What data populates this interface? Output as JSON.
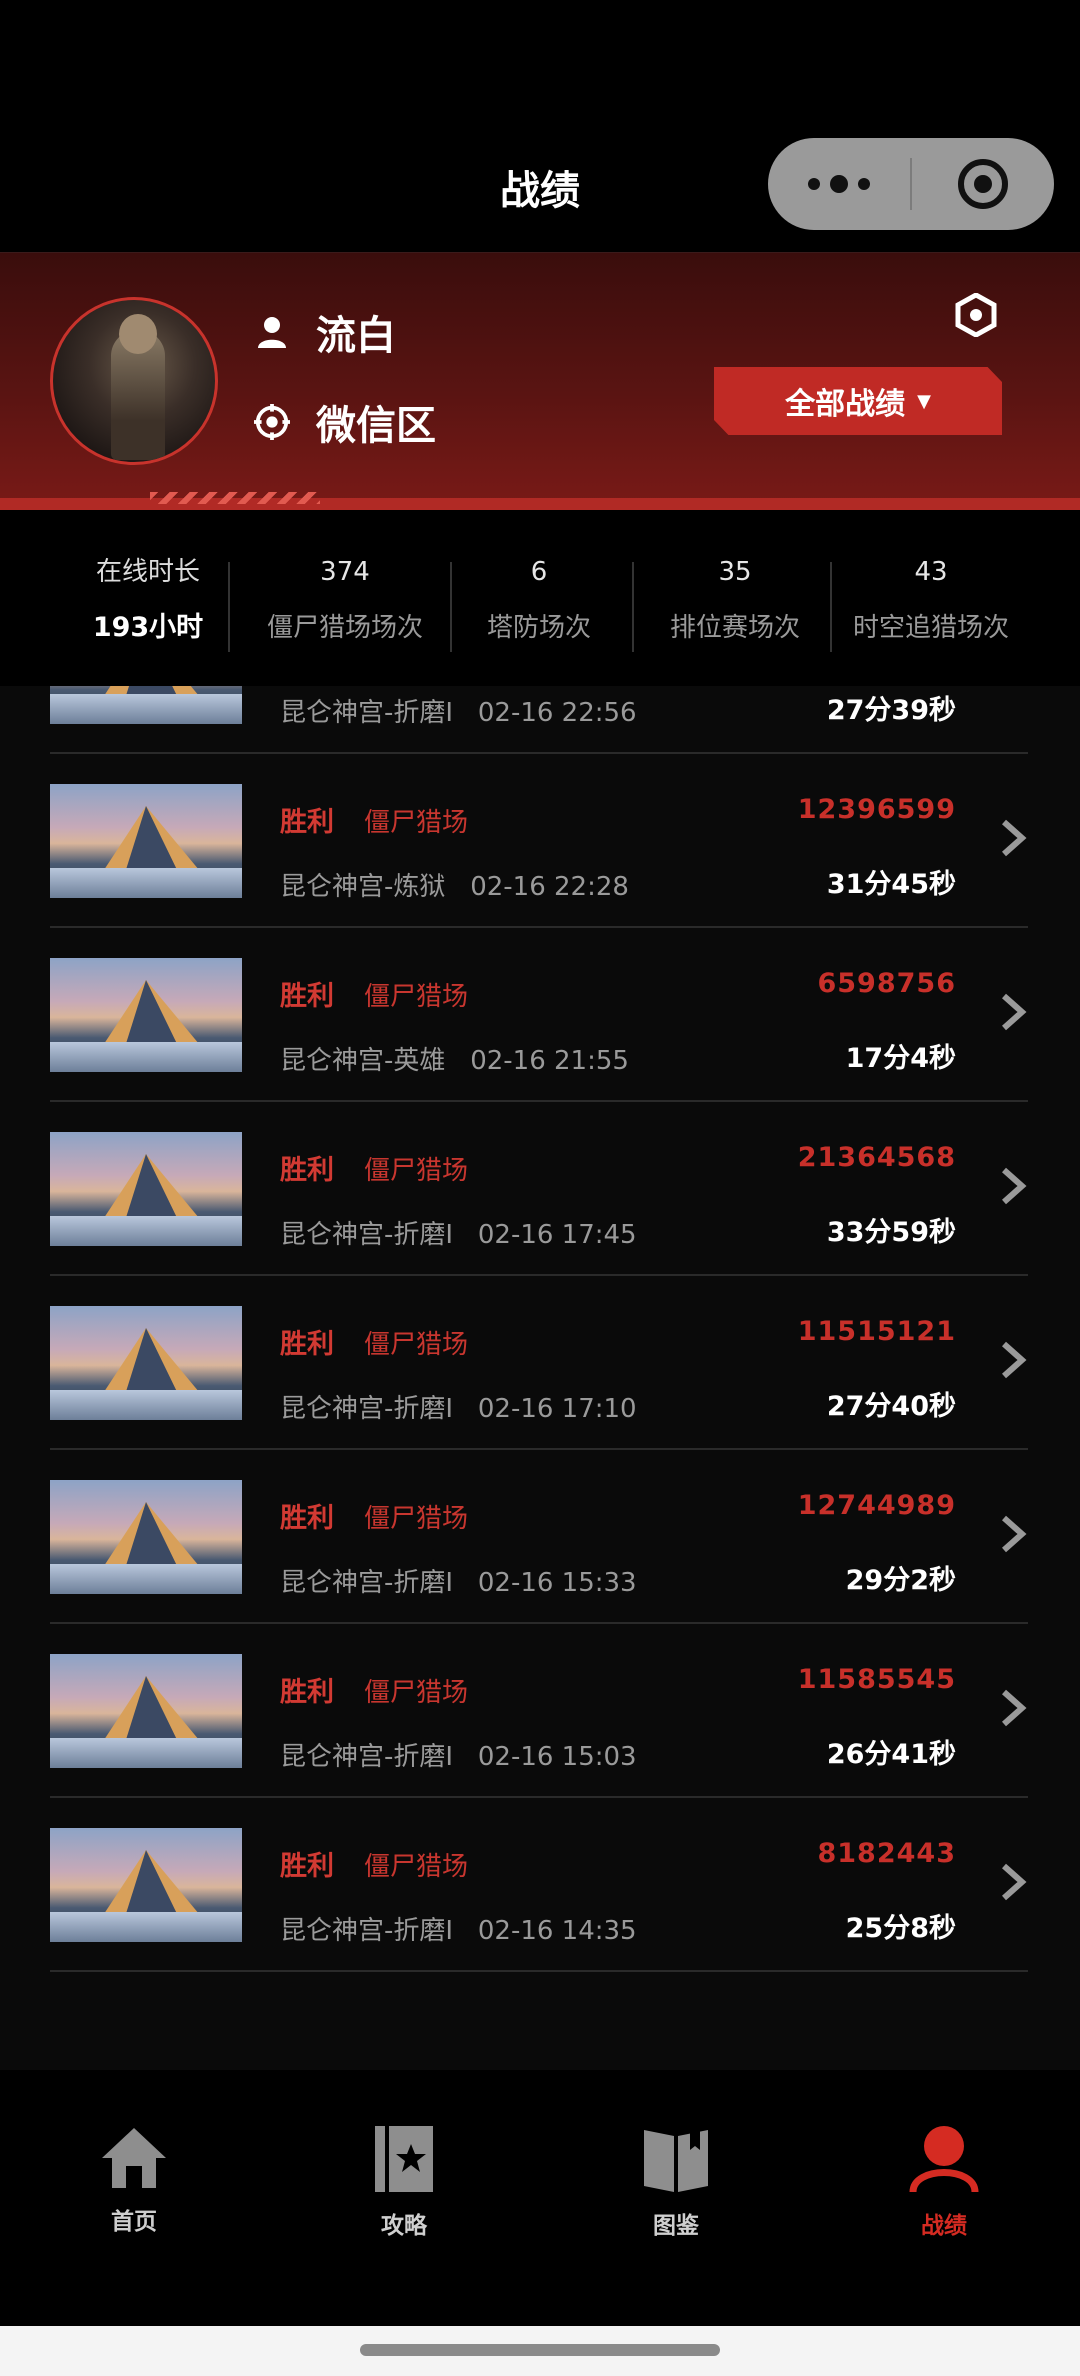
{
  "header": {
    "title": "战绩"
  },
  "profile": {
    "name": "流白",
    "region": "微信区",
    "filter_button": "全部战绩",
    "filter_caret": "▼"
  },
  "stats": [
    {
      "value": "193小时",
      "label": "在线时长"
    },
    {
      "value": "374",
      "label": "僵尸猎场场次"
    },
    {
      "value": "6",
      "label": "塔防场次"
    },
    {
      "value": "35",
      "label": "排位赛场次"
    },
    {
      "value": "43",
      "label": "时空追猎场次"
    }
  ],
  "matches": [
    {
      "result": "",
      "mode": "",
      "map": "昆仑神宫-折磨I",
      "time": "02-16 22:56",
      "score": "",
      "duration": "27分39秒"
    },
    {
      "result": "胜利",
      "mode": "僵尸猎场",
      "map": "昆仑神宫-炼狱",
      "time": "02-16 22:28",
      "score": "12396599",
      "duration": "31分45秒"
    },
    {
      "result": "胜利",
      "mode": "僵尸猎场",
      "map": "昆仑神宫-英雄",
      "time": "02-16 21:55",
      "score": "6598756",
      "duration": "17分4秒"
    },
    {
      "result": "胜利",
      "mode": "僵尸猎场",
      "map": "昆仑神宫-折磨I",
      "time": "02-16 17:45",
      "score": "21364568",
      "duration": "33分59秒"
    },
    {
      "result": "胜利",
      "mode": "僵尸猎场",
      "map": "昆仑神宫-折磨I",
      "time": "02-16 17:10",
      "score": "11515121",
      "duration": "27分40秒"
    },
    {
      "result": "胜利",
      "mode": "僵尸猎场",
      "map": "昆仑神宫-折磨I",
      "time": "02-16 15:33",
      "score": "12744989",
      "duration": "29分2秒"
    },
    {
      "result": "胜利",
      "mode": "僵尸猎场",
      "map": "昆仑神宫-折磨I",
      "time": "02-16 15:03",
      "score": "11585545",
      "duration": "26分41秒"
    },
    {
      "result": "胜利",
      "mode": "僵尸猎场",
      "map": "昆仑神宫-折磨I",
      "time": "02-16 14:35",
      "score": "8182443",
      "duration": "25分8秒"
    }
  ],
  "tabbar": {
    "home": "首页",
    "guide": "攻略",
    "encyclopedia": "图鉴",
    "record": "战绩"
  },
  "colors": {
    "accent": "#d52b22",
    "header_bg": "#5a1412",
    "button_bg": "#c02a25"
  },
  "icons": [
    "more-icon",
    "target-icon",
    "user-icon",
    "region-icon",
    "hexagon-icon",
    "chevron-right-icon",
    "home-icon",
    "guide-icon",
    "encyclopedia-icon",
    "record-icon"
  ]
}
